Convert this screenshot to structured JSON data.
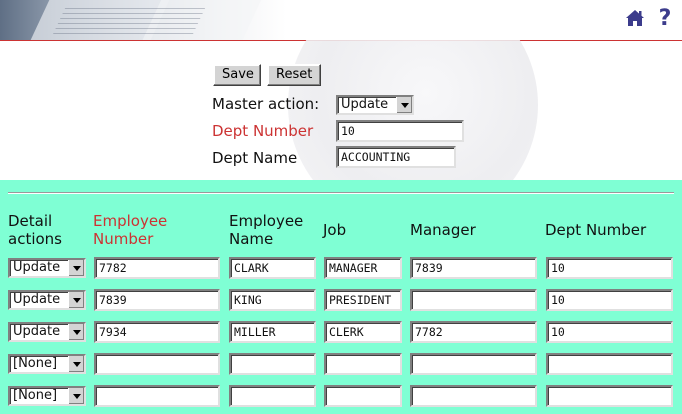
{
  "header": {
    "home_icon": "home-icon",
    "help_icon": "help-icon",
    "help_glyph": "?"
  },
  "master": {
    "save_label": "Save",
    "reset_label": "Reset",
    "action_label": "Master action:",
    "action_value": "Update",
    "dept_number_label": "Dept Number",
    "dept_number_value": "10",
    "dept_name_label": "Dept Name",
    "dept_name_value": "ACCOUNTING",
    "required_color": "#cc3333"
  },
  "detail": {
    "background_color": "#7fffd4",
    "headers": {
      "actions": [
        "Detail",
        "actions"
      ],
      "employee_number": [
        "Employee",
        "Number"
      ],
      "employee_name": [
        "Employee",
        "Name"
      ],
      "job": "Job",
      "manager": "Manager",
      "dept_number": "Dept Number"
    },
    "rows": [
      {
        "action": "Update",
        "empno": "7782",
        "ename": "CLARK",
        "job": "MANAGER",
        "mgr": "7839",
        "deptno": "10"
      },
      {
        "action": "Update",
        "empno": "7839",
        "ename": "KING",
        "job": "PRESIDENT",
        "mgr": "",
        "deptno": "10"
      },
      {
        "action": "Update",
        "empno": "7934",
        "ename": "MILLER",
        "job": "CLERK",
        "mgr": "7782",
        "deptno": "10"
      },
      {
        "action": "[None]",
        "empno": "",
        "ename": "",
        "job": "",
        "mgr": "",
        "deptno": ""
      },
      {
        "action": "[None]",
        "empno": "",
        "ename": "",
        "job": "",
        "mgr": "",
        "deptno": ""
      }
    ]
  }
}
